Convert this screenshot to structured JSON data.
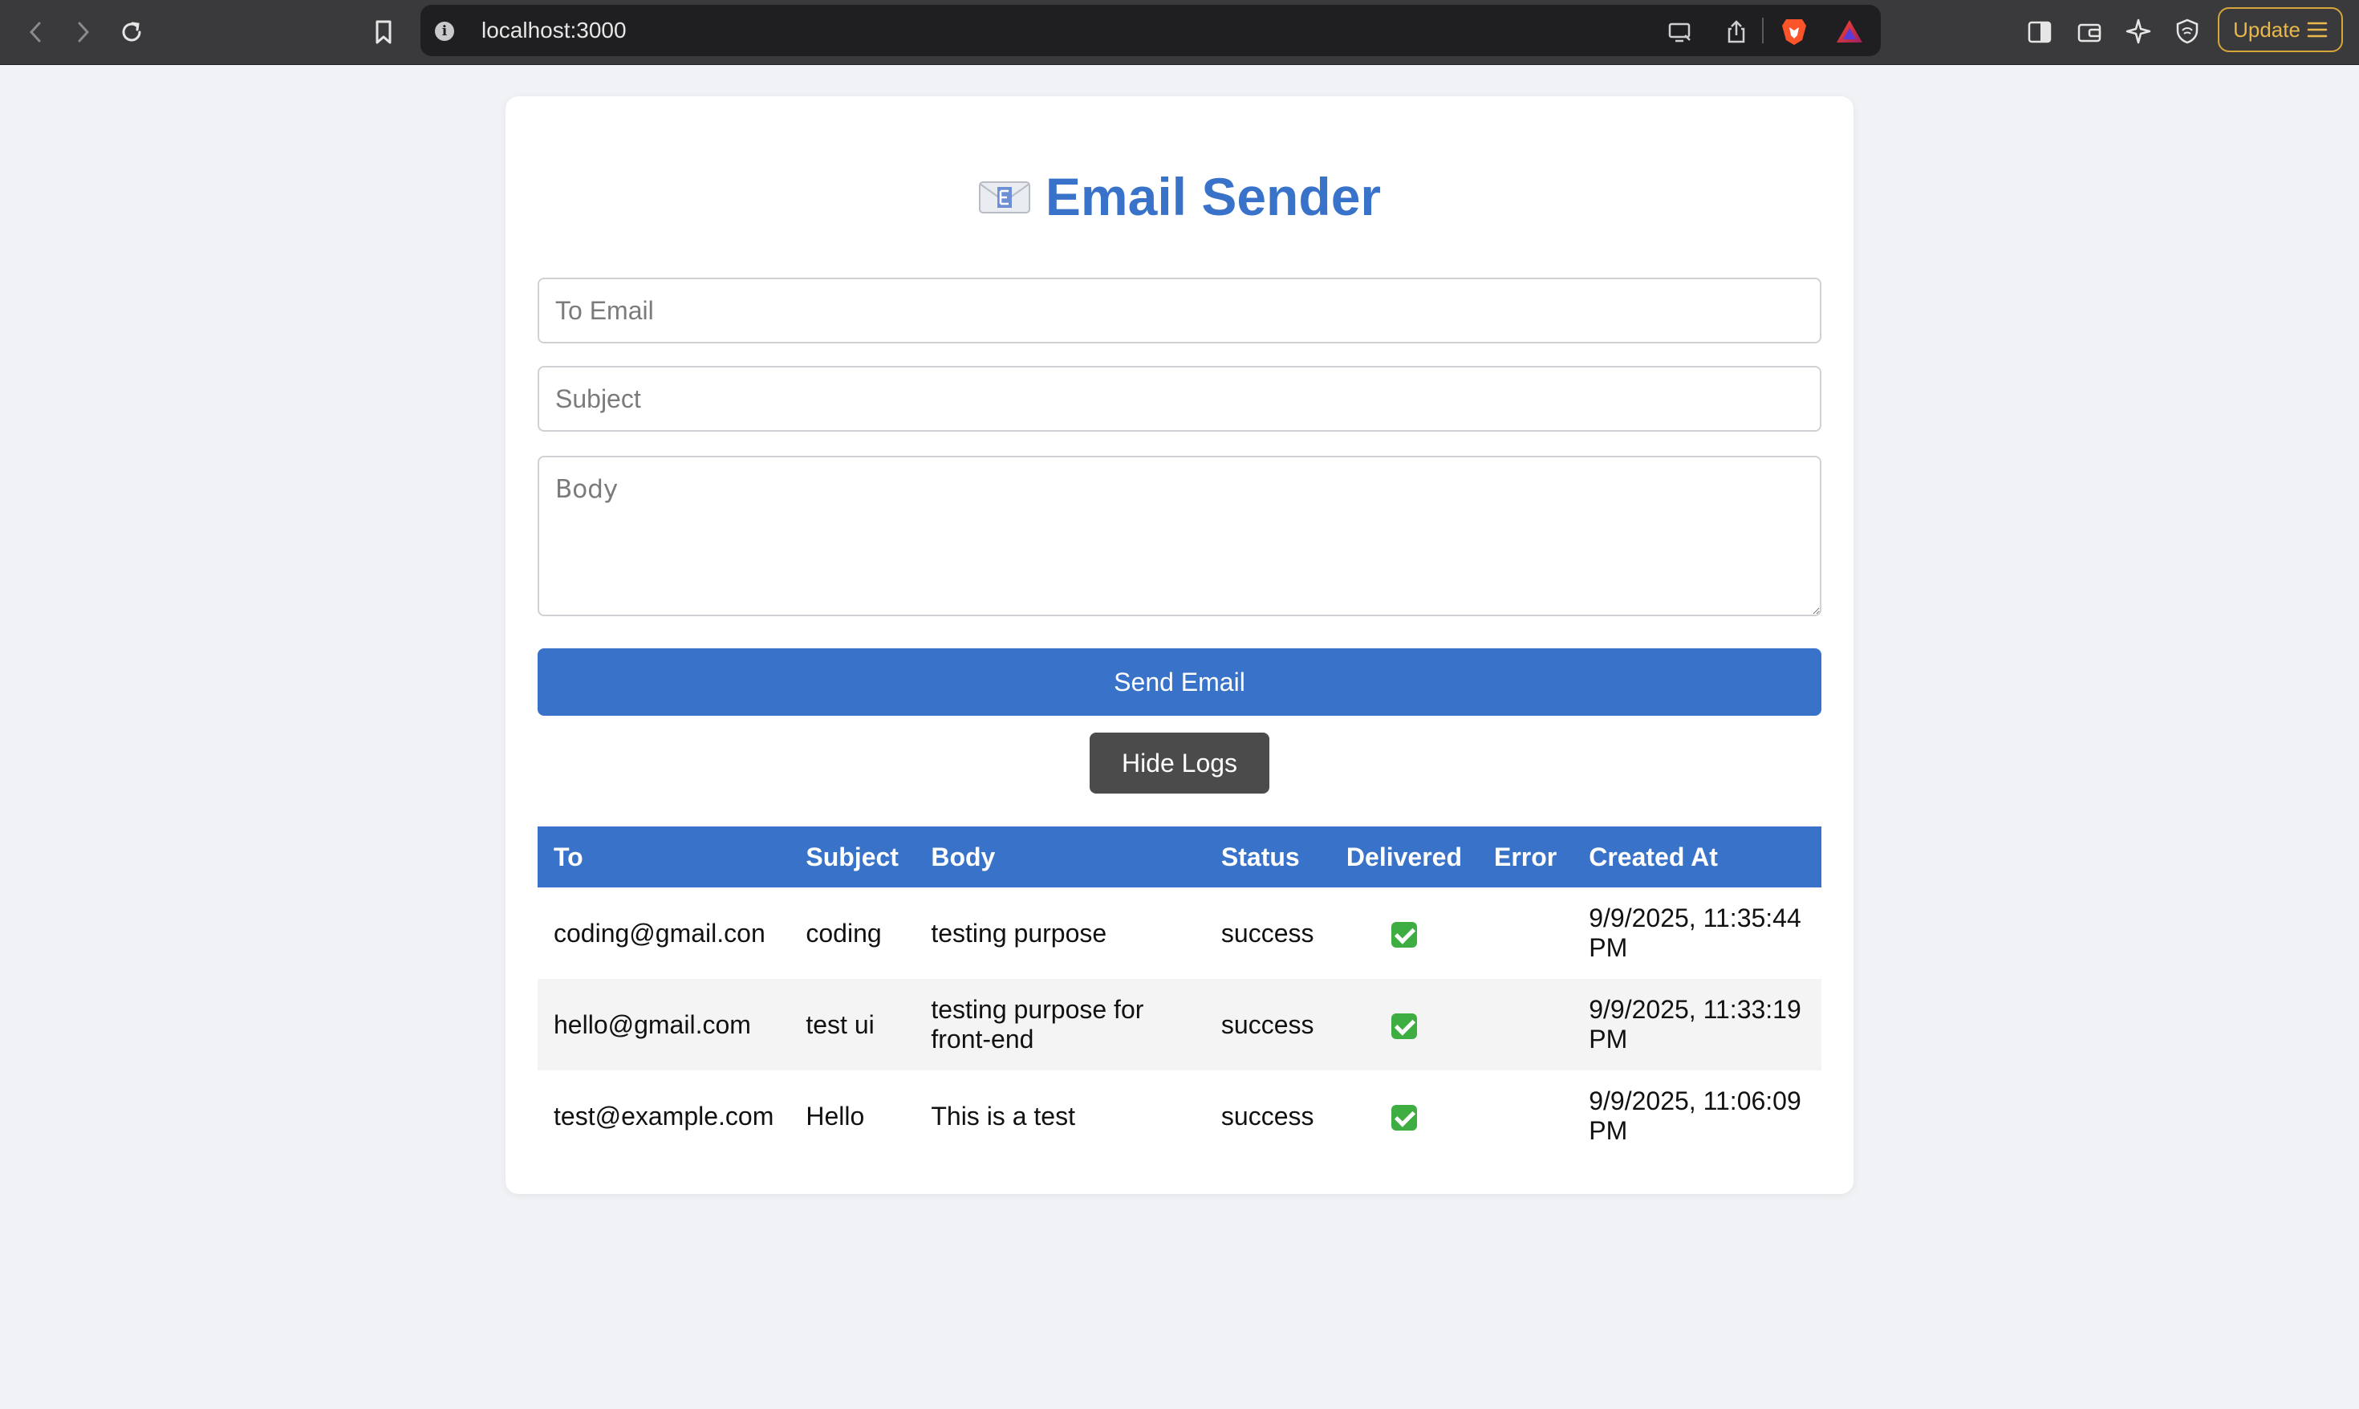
{
  "browser": {
    "url": "localhost:3000",
    "update_label": "Update"
  },
  "app": {
    "title": "Email Sender",
    "fields": {
      "to_placeholder": "To Email",
      "subject_placeholder": "Subject",
      "body_placeholder": "Body"
    },
    "send_label": "Send Email",
    "logs_toggle_label": "Hide Logs"
  },
  "logs": {
    "columns": [
      "To",
      "Subject",
      "Body",
      "Status",
      "Delivered",
      "Error",
      "Created At"
    ],
    "rows": [
      {
        "to": "coding@gmail.con",
        "subject": "coding",
        "body": "testing purpose",
        "status": "success",
        "delivered": "check-icon",
        "error": "",
        "created_at": "9/9/2025, 11:35:44 PM"
      },
      {
        "to": "hello@gmail.com",
        "subject": "test ui",
        "body": "testing purpose for front-end",
        "status": "success",
        "delivered": "check-icon",
        "error": "",
        "created_at": "9/9/2025, 11:33:19 PM"
      },
      {
        "to": "test@example.com",
        "subject": "Hello",
        "body": "This is a test",
        "status": "success",
        "delivered": "check-icon",
        "error": "",
        "created_at": "9/9/2025, 11:06:09 PM"
      }
    ]
  },
  "colors": {
    "accent": "#3872c9",
    "secondary_button": "#4b4b4b",
    "success_check": "#3fae42",
    "page_background": "#f0f2f5"
  }
}
